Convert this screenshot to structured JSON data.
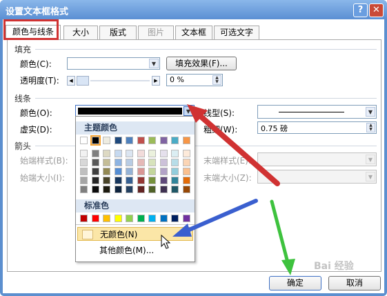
{
  "window": {
    "title": "设置文本框格式"
  },
  "titlebar_buttons": {
    "help": "?",
    "close": "✕"
  },
  "tabs": [
    {
      "label": "颜色与线条",
      "active": true
    },
    {
      "label": "大小"
    },
    {
      "label": "版式"
    },
    {
      "label": "图片",
      "disabled": true
    },
    {
      "label": "文本框"
    },
    {
      "label": "可选文字"
    }
  ],
  "fill": {
    "section": "填充",
    "color_label": "颜色(C):",
    "color_value": "",
    "effects_button": "填充效果(F)...",
    "transparency_label": "透明度(T):",
    "transparency_value": "0 %"
  },
  "line": {
    "section": "线条",
    "color_label": "颜色(O):",
    "color_value": "#000000",
    "style_label": "线型(S):",
    "dash_label": "虚实(D):",
    "weight_label": "粗细(W):",
    "weight_value": "0.75 磅"
  },
  "arrows": {
    "section": "箭头",
    "begin_style_label": "始端样式(B):",
    "begin_size_label": "始端大小(I):",
    "end_style_label": "末端样式(E):",
    "end_size_label": "末端大小(Z):"
  },
  "color_popup": {
    "theme_header": "主题颜色",
    "theme_top": [
      "#ffffff",
      "#000000",
      "#eeece1",
      "#1f497d",
      "#4f81bd",
      "#c0504d",
      "#9bbb59",
      "#8064a2",
      "#4bacc6",
      "#f79646"
    ],
    "theme_shades": [
      [
        "#f2f2f2",
        "#7f7f7f",
        "#ddd9c3",
        "#c6d9f0",
        "#dbe5f1",
        "#f2dcdb",
        "#ebf1dd",
        "#e5e0ec",
        "#dbeef3",
        "#fdeada"
      ],
      [
        "#d8d8d8",
        "#595959",
        "#c4bd97",
        "#8db3e2",
        "#b8cce4",
        "#e5b9b7",
        "#d7e3bc",
        "#ccc1d9",
        "#b7dde8",
        "#fbd5b5"
      ],
      [
        "#bfbfbf",
        "#3f3f3f",
        "#938953",
        "#548dd4",
        "#95b3d7",
        "#d99694",
        "#c3d69b",
        "#b2a2c7",
        "#92cddc",
        "#fac08f"
      ],
      [
        "#a5a5a5",
        "#262626",
        "#494429",
        "#17365d",
        "#366092",
        "#953734",
        "#76923c",
        "#5f497a",
        "#31859b",
        "#e36c09"
      ],
      [
        "#7f7f7f",
        "#0c0c0c",
        "#1d1b10",
        "#0f243e",
        "#244061",
        "#632423",
        "#4f6128",
        "#3f3151",
        "#205867",
        "#974806"
      ]
    ],
    "standard_header": "标准色",
    "standard": [
      "#c00000",
      "#ff0000",
      "#ffc000",
      "#ffff00",
      "#92d050",
      "#00b050",
      "#00b0f0",
      "#0070c0",
      "#002060",
      "#7030a0"
    ],
    "no_color": "无颜色(N)",
    "more_colors": "其他颜色(M)..."
  },
  "footer": {
    "ok": "确定",
    "cancel": "取消"
  },
  "watermark": "Bai 经验",
  "annotation_colors": {
    "red": "#d03232",
    "blue": "#3a5fcf",
    "green": "#3ec23e"
  }
}
